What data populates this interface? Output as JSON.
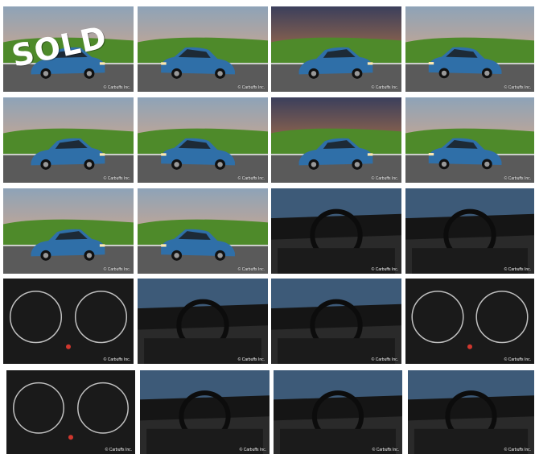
{
  "gallery": {
    "sold_label": "SOLD",
    "watermark": "© Carbuffs Inc.",
    "photos": [
      {
        "subject": "exterior-front-three-quarter-sold",
        "scene": "exterior"
      },
      {
        "subject": "exterior-front",
        "scene": "exterior"
      },
      {
        "subject": "exterior-front-sunset",
        "scene": "sunset"
      },
      {
        "subject": "exterior-side-profile",
        "scene": "exterior"
      },
      {
        "subject": "exterior-rear-three-quarter-tower",
        "scene": "exterior"
      },
      {
        "subject": "exterior-rear-three-quarter",
        "scene": "exterior"
      },
      {
        "subject": "exterior-rear-sunset",
        "scene": "sunset"
      },
      {
        "subject": "exterior-rear-right",
        "scene": "exterior"
      },
      {
        "subject": "exterior-side-left",
        "scene": "exterior"
      },
      {
        "subject": "exterior-front-three-quarter-tower",
        "scene": "exterior"
      },
      {
        "subject": "interior-dashboard-door",
        "scene": "interior"
      },
      {
        "subject": "steering-wheel",
        "scene": "interior"
      },
      {
        "subject": "instrument-cluster",
        "scene": "dark"
      },
      {
        "subject": "interior-dashboard-wide",
        "scene": "interior"
      },
      {
        "subject": "center-console-radio",
        "scene": "interior"
      },
      {
        "subject": "climate-controls",
        "scene": "dark"
      },
      {
        "subject": "gear-shifter-detail",
        "scene": "dark"
      },
      {
        "subject": "front-seats-open-door",
        "scene": "interior"
      },
      {
        "subject": "rear-seats-left",
        "scene": "interior"
      },
      {
        "subject": "rear-seats-right",
        "scene": "interior"
      }
    ]
  },
  "colors": {
    "car_blue": "#2f6fa8",
    "sky_sunset": "#f0a874",
    "grass": "#4e8a2a",
    "road": "#5a5a5a",
    "interior_dark": "#1a1a1a"
  }
}
